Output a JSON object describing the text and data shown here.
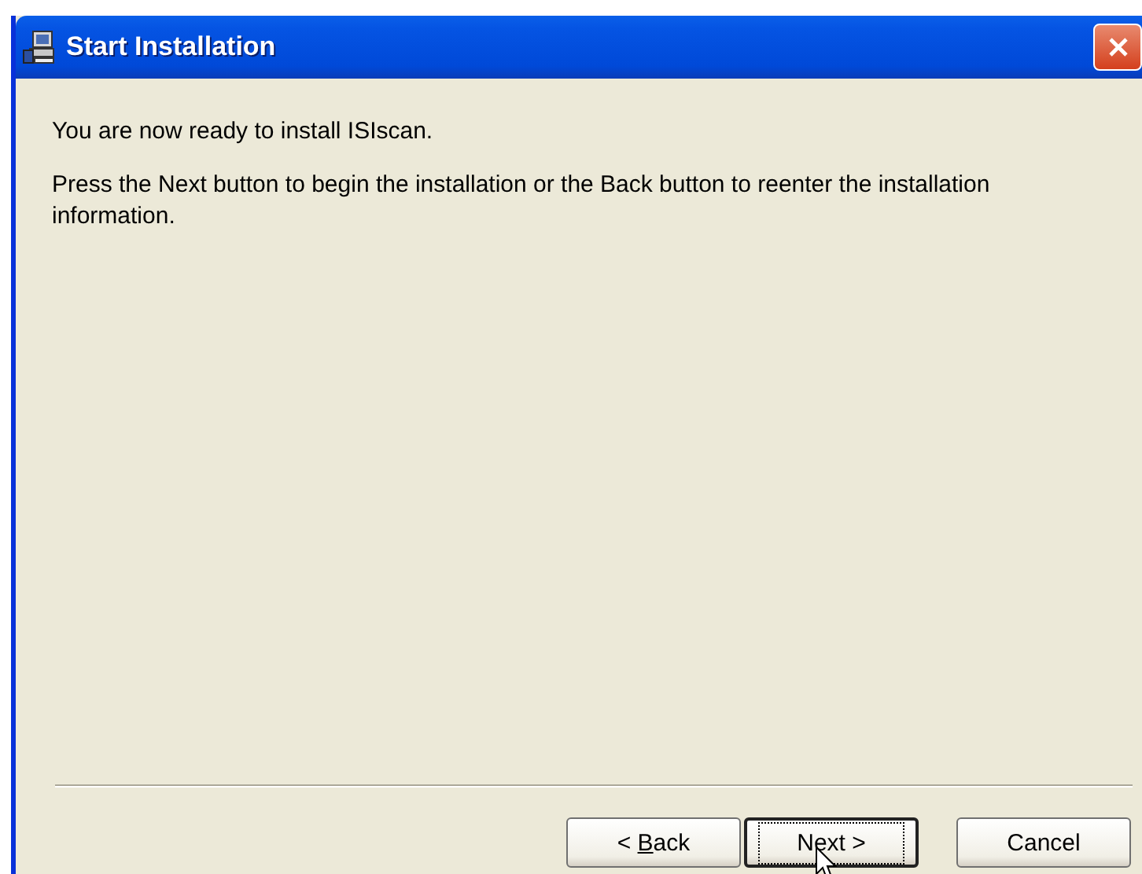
{
  "window": {
    "title": "Start Installation"
  },
  "body": {
    "paragraphs": [
      "You are now ready to install ISIscan.",
      "Press the Next button to begin the installation or the Back button to reenter the installation information."
    ]
  },
  "buttons": [
    {
      "before": "< ",
      "key": "B",
      "after": "ack",
      "default": false,
      "focused": false
    },
    {
      "after": "Next >",
      "default": true,
      "focused": true
    },
    {
      "after": "Cancel",
      "default": false,
      "focused": false
    }
  ]
}
